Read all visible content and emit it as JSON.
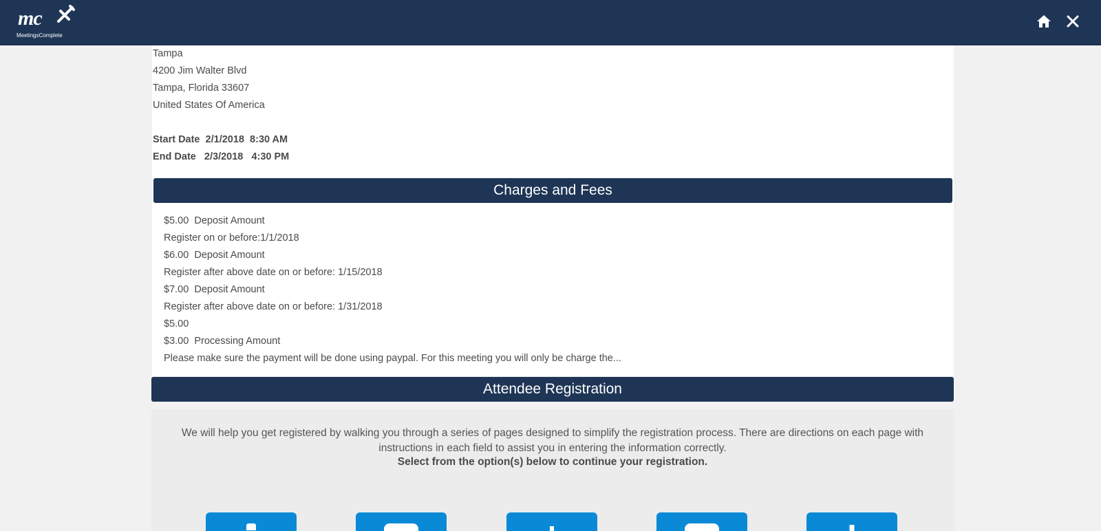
{
  "header": {
    "logo_text": "mc",
    "logo_brand": "MeetingsComplete",
    "icons": [
      "home-icon",
      "close-icon"
    ]
  },
  "location": {
    "lines": [
      "Tampa",
      "4200 Jim Walter Blvd",
      "Tampa, Florida 33607",
      "United States Of America"
    ],
    "start": "Start Date  2/1/2018  8:30 AM",
    "end": "End Date   2/3/2018   4:30 PM"
  },
  "charges": {
    "title": "Charges and Fees",
    "lines": [
      "$5.00  Deposit Amount",
      "Register on or before:1/1/2018",
      "$6.00  Deposit Amount",
      "Register after above date on or before: 1/15/2018",
      "$7.00  Deposit Amount",
      "Register after above date on or before: 1/31/2018",
      "$5.00",
      "$3.00  Processing Amount",
      "Please make sure the payment will be done using paypal. For this meeting you will only be charge the..."
    ]
  },
  "registration": {
    "title": "Attendee Registration",
    "intro": "We will help you get registered by walking you through a series of pages designed to simplify the registration process. There are directions on each page with instructions in each field to assist you in entering the information correctly.",
    "prompt": "Select from the option(s) below to continue your registration.",
    "options": [
      "clipboard-icon",
      "card-icon",
      "person-icon",
      "id-card-icon",
      "add-icon"
    ]
  },
  "colors": {
    "header_bg": "#1e3556",
    "button_bg": "#0a8ad6"
  }
}
